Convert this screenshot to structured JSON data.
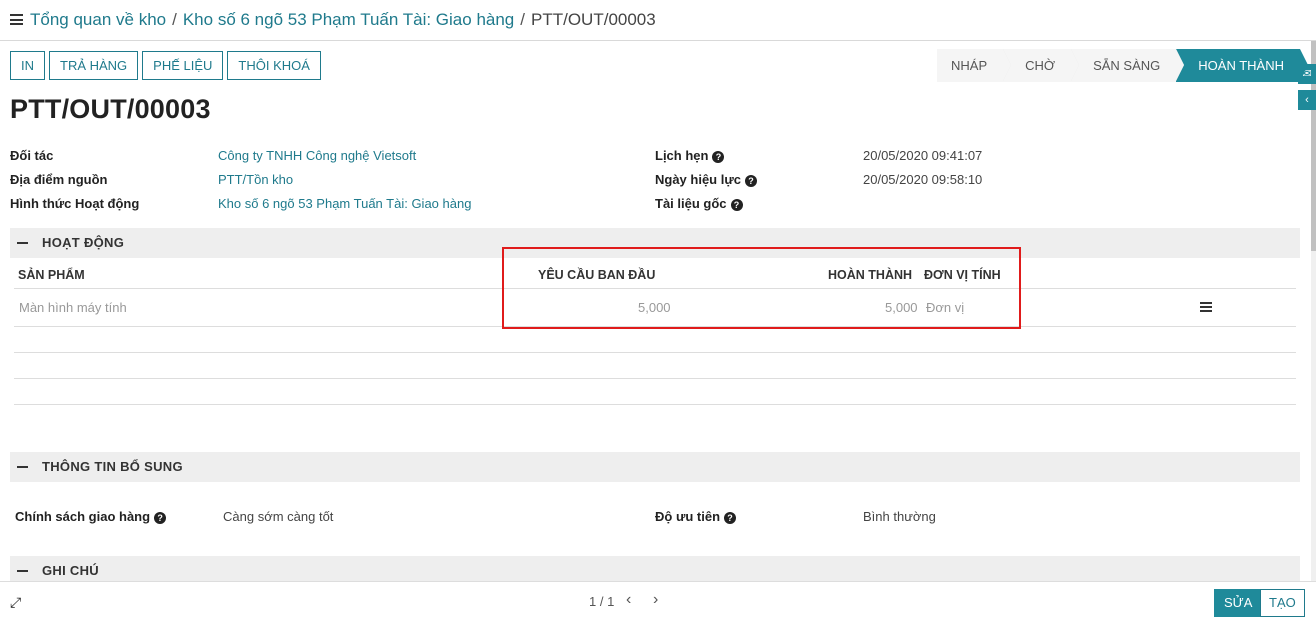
{
  "breadcrumb": {
    "items": [
      "Tổng quan về kho",
      "Kho số 6 ngõ 53 Phạm Tuấn Tài: Giao hàng"
    ],
    "current": "PTT/OUT/00003",
    "separator": "/"
  },
  "actions": {
    "print": "IN",
    "return": "TRẢ HÀNG",
    "scrap": "PHẾ LIỆU",
    "unlock": "THÔI KHOÁ"
  },
  "statusbar": {
    "stages": [
      "NHÁP",
      "CHỜ",
      "SẴN SÀNG",
      "HOÀN THÀNH"
    ],
    "active": "HOÀN THÀNH"
  },
  "record": {
    "title": "PTT/OUT/00003",
    "left_fields": [
      {
        "label": "Đối tác",
        "value": "Công ty TNHH Công nghệ Vietsoft"
      },
      {
        "label": "Địa điểm nguồn",
        "value": "PTT/Tồn kho"
      },
      {
        "label": "Hình thức Hoạt động",
        "value": "Kho số 6 ngõ 53 Phạm Tuấn Tài: Giao hàng"
      }
    ],
    "right_fields": [
      {
        "label": "Lịch hẹn",
        "value": "20/05/2020 09:41:07"
      },
      {
        "label": "Ngày hiệu lực",
        "value": "20/05/2020 09:58:10"
      },
      {
        "label": "Tài liệu gốc",
        "value": ""
      }
    ]
  },
  "operations": {
    "section_title": "HOẠT ĐỘNG",
    "columns": [
      "SẢN PHẨM",
      "YÊU CẦU BAN ĐẦU",
      "HOÀN THÀNH",
      "ĐƠN VỊ TÍNH"
    ],
    "rows": [
      {
        "product": "Màn hình máy tính",
        "initial_demand": "5,000",
        "done": "5,000",
        "uom": "Đơn vị"
      }
    ]
  },
  "additional_info": {
    "section_title": "THÔNG TIN BỔ SUNG",
    "shipping_policy_label": "Chính sách giao hàng",
    "shipping_policy_value": "Càng sớm càng tốt",
    "priority_label": "Độ ưu tiên",
    "priority_value": "Bình thường"
  },
  "notes": {
    "section_title": "GHI CHÚ"
  },
  "footer": {
    "pager": "1 / 1",
    "edit": "SỬA",
    "create": "TẠO"
  },
  "colors": {
    "accent": "#1f8a9a",
    "link": "#1f7a8c",
    "highlight": "#e01b1b"
  },
  "icons": [
    "hamburger-icon",
    "help-icon",
    "collapse-dash-icon",
    "list-detail-icon",
    "expand-icon",
    "chevron-left-icon",
    "chevron-right-icon",
    "chat-icon",
    "collapse-arrow-icon"
  ]
}
